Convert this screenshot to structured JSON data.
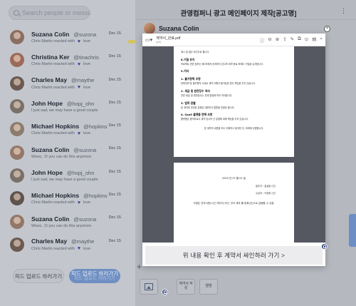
{
  "sidebar": {
    "search_placeholder": "Search people or message",
    "chats": [
      {
        "name": "Suzana Colin",
        "handle": "@suzona",
        "date": "Dec 15",
        "preview": "Chris Martin reacted with",
        "reaction": "love",
        "avatar_color": "#8a6e62",
        "unread": true
      },
      {
        "name": "Christina Ker",
        "handle": "@tinachris",
        "date": "Dec 15",
        "preview": "Chris Martin reacted with",
        "reaction": "love",
        "avatar_color": "#9c6a5a",
        "unread": false
      },
      {
        "name": "Charles May",
        "handle": "@maythe",
        "date": "Dec 15",
        "preview": "Chris Martin reacted with",
        "reaction": "love",
        "avatar_color": "#6b5a52",
        "unread": false
      },
      {
        "name": "John Hope",
        "handle": "@hopj_ohn",
        "date": "Dec 15",
        "preview": "I just sad, we may have a good couple",
        "reaction": "",
        "avatar_color": "#7a7068",
        "unread": false
      },
      {
        "name": "Michael Hopkins",
        "handle": "@hopkins",
        "date": "Dec 15",
        "preview": "Chris Martin reacted with",
        "reaction": "love",
        "avatar_color": "#8c7b6e",
        "unread": false
      },
      {
        "name": "Suzana Colin",
        "handle": "@suzona",
        "date": "Dec 15",
        "preview": "Wooo, :D you can do this anymore",
        "reaction": "",
        "avatar_color": "#93786a",
        "unread": false
      },
      {
        "name": "John Hope",
        "handle": "@hopj_ohn",
        "date": "Dec 15",
        "preview": "I just sad, we may have a good couple",
        "reaction": "",
        "avatar_color": "#7a7068",
        "unread": false
      },
      {
        "name": "Michael Hopkins",
        "handle": "@hopkins",
        "date": "Dec 15",
        "preview": "Chris Martin reacted with",
        "reaction": "love",
        "avatar_color": "#5f534d",
        "unread": false
      },
      {
        "name": "Suzana Colin",
        "handle": "@suzona",
        "date": "Dec 15",
        "preview": "Wooo, :D you can do this anymore",
        "reaction": "",
        "avatar_color": "#93786a",
        "unread": false
      },
      {
        "name": "Charles May",
        "handle": "@maythe",
        "date": "Dec 15",
        "preview": "Chris Martin reacted with",
        "reaction": "love",
        "avatar_color": "#6b5a52",
        "unread": false
      }
    ],
    "feed_upload_label": "피드 업로드 하러가기",
    "feed_upload_active_label": "피드 업로드 하러가기"
  },
  "chat": {
    "title": "관영컴퍼니 광고 메인페이지 제작[공고명]",
    "more_icon": "more-dots-icon",
    "sender_name": "Suzana Colin",
    "composer": {
      "image_icon": "image-icon",
      "contract_label": "계약서 작성",
      "photo_label": "앨범"
    }
  },
  "modal": {
    "close_icon": "close-icon",
    "file_name": "계약서_완료.pdf",
    "file_size": "(pdf)",
    "page1": {
      "intro": "계시 및 결산 조건으로 합니다.",
      "s1_title": "8.기밀 유지",
      "s1_body": "프로젝트 관련 정보는 제3자에게 공개하지 않으며 계약 종료 후에도 기밀을 유지합니다.",
      "s2_title": "9.기타",
      "s2a_title": "1. 불가항력 조항",
      "s2a_body": "천재지변 등 불가항력 사유로 계약 이행이 불가능한 경우 책임을 지지 않습니다.",
      "s2b_title": "2. 세금 및 원천징수 처리",
      "s2b_body": "관련 세금 및 원천징수는 관계 법령에 따라 처리합니다.",
      "s2c_title": "3. 법적 관할",
      "s2c_body": "본 계약과 관련된 분쟁은 대한민국 법원을 관할로 합니다.",
      "s2d_title": "4. SaaS 플랫폼 면책 조항",
      "s2d_body": "플랫폼은 중개자로서 계약 당사자 간 분쟁에 대해 책임을 지지 않습니다.",
      "closing": "본 계약의 내용을 모두 이해하고 동의한 뒤, 아래에 서명합니다."
    },
    "page2": {
      "date": "2025 년 07 월 01 일",
      "party1": "발주자 : 홍길동 (인)",
      "party2": "수급자 : 이영희 (인)",
      "note": "서명은 전자서명(시인 이미지) 또는 전자 계약 툴 등록(인)으로 갈음할 수 있음."
    },
    "cta_label": "위 내용 확인 후 계약서 싸인하러 가기 >"
  }
}
